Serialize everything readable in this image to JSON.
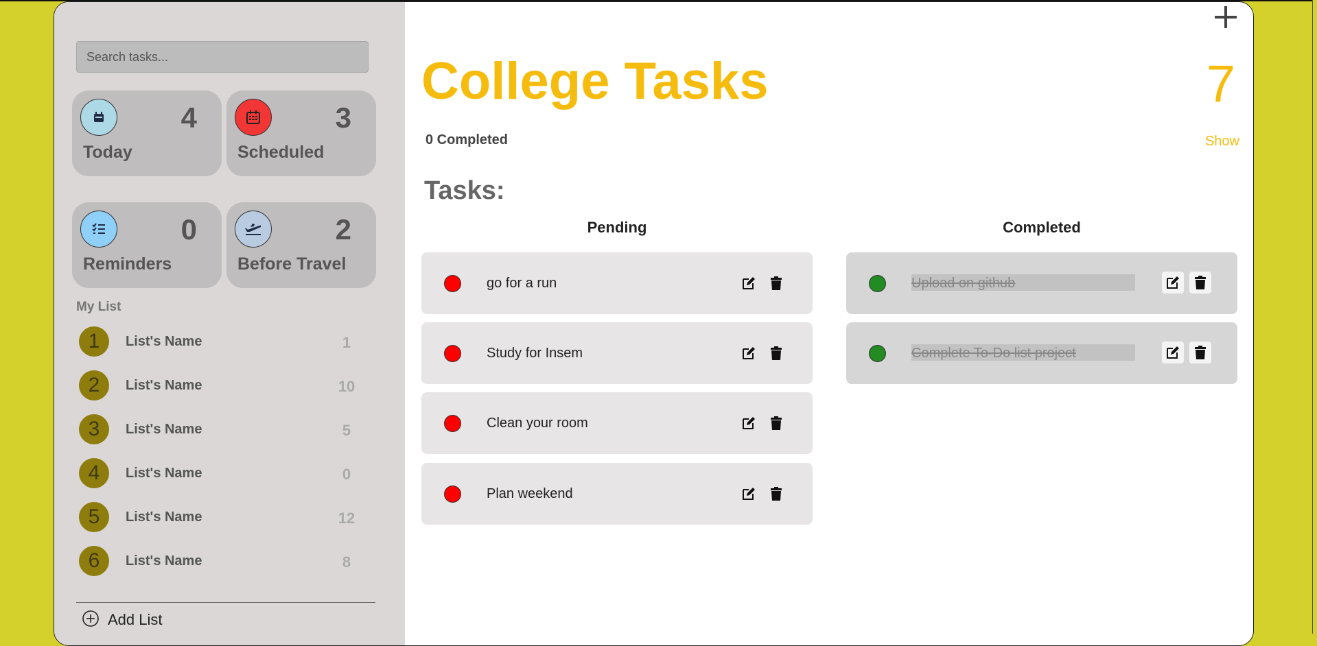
{
  "sidebar": {
    "search_placeholder": "Search tasks...",
    "cards": [
      {
        "label": "Today",
        "count": "4",
        "icon": "calendar-icon",
        "color": "#add8e6"
      },
      {
        "label": "Scheduled",
        "count": "3",
        "icon": "calendar-grid-icon",
        "color": "#f23535"
      },
      {
        "label": "Reminders",
        "count": "0",
        "icon": "checklist-icon",
        "color": "#8fd0f8"
      },
      {
        "label": "Before Travel",
        "count": "2",
        "icon": "plane-departure-icon",
        "color": "#b8cbe0"
      }
    ],
    "my_list_title": "My List",
    "lists": [
      {
        "num": "1",
        "name": "List's Name",
        "count": "1"
      },
      {
        "num": "2",
        "name": "List's Name",
        "count": "10"
      },
      {
        "num": "3",
        "name": "List's Name",
        "count": "5"
      },
      {
        "num": "4",
        "name": "List's Name",
        "count": "0"
      },
      {
        "num": "5",
        "name": "List's Name",
        "count": "12"
      },
      {
        "num": "6",
        "name": "List's Name",
        "count": "8"
      }
    ],
    "add_list_label": "Add List"
  },
  "main": {
    "add_icon": "plus-icon",
    "title": "College Tasks",
    "total": "7",
    "completed_label": "0 Completed",
    "show_label": "Show",
    "tasks_heading": "Tasks:",
    "pending_heading": "Pending",
    "completed_heading": "Completed",
    "pending": [
      {
        "text": "go for a run"
      },
      {
        "text": "Study for Insem"
      },
      {
        "text": "Clean your room"
      },
      {
        "text": "Plan weekend"
      }
    ],
    "completed": [
      {
        "text": "Upload on github"
      },
      {
        "text": "Complete To-Do list project"
      }
    ]
  },
  "colors": {
    "background": "#d4d02c",
    "accent": "#f5bc0e",
    "pending_dot": "#ff0000",
    "done_dot": "#228b22",
    "list_badge": "#8e7c0d"
  }
}
